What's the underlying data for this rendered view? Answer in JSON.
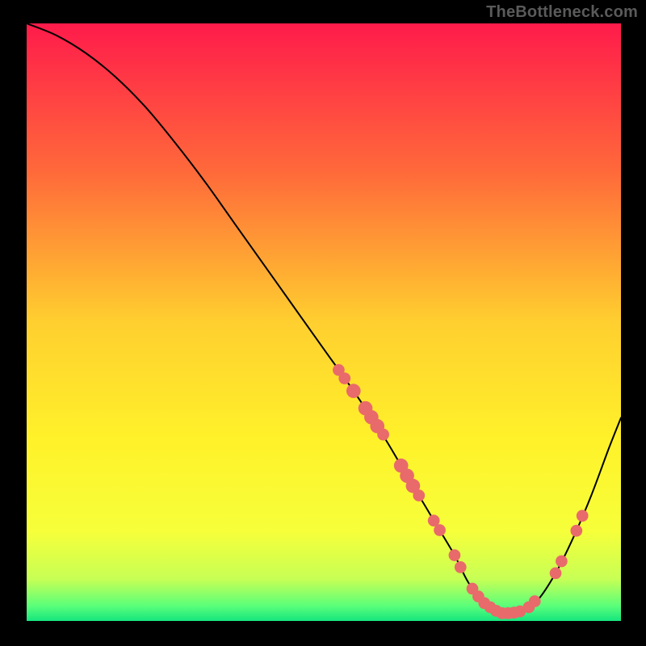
{
  "watermark": "TheBottleneck.com",
  "chart_data": {
    "type": "line",
    "title": "",
    "xlabel": "",
    "ylabel": "",
    "xlim": [
      0,
      100
    ],
    "ylim": [
      0,
      100
    ],
    "grid": false,
    "legend": false,
    "gradient_stops": [
      {
        "offset": 0.0,
        "color": "#ff1b4b"
      },
      {
        "offset": 0.25,
        "color": "#ff6a3a"
      },
      {
        "offset": 0.5,
        "color": "#ffcf2f"
      },
      {
        "offset": 0.7,
        "color": "#fff22a"
      },
      {
        "offset": 0.85,
        "color": "#f6ff3a"
      },
      {
        "offset": 0.93,
        "color": "#c7ff55"
      },
      {
        "offset": 0.975,
        "color": "#5aff7a"
      },
      {
        "offset": 1.0,
        "color": "#15e57e"
      }
    ],
    "series": [
      {
        "name": "bottleneck-curve",
        "x": [
          0,
          5,
          10,
          15,
          20,
          25,
          30,
          35,
          40,
          45,
          50,
          55,
          60,
          63,
          66,
          69,
          72,
          74,
          76,
          78,
          80,
          83,
          86,
          89,
          92,
          95,
          98,
          100
        ],
        "values": [
          100,
          98,
          95,
          91,
          86,
          80,
          73.5,
          66.5,
          59.5,
          52.5,
          45.5,
          38.5,
          31,
          26,
          21,
          16,
          11,
          7,
          4,
          2.3,
          1.3,
          1.3,
          3.5,
          8,
          14,
          21,
          29,
          34
        ]
      }
    ],
    "markers": {
      "name": "highlight-points",
      "color": "#e96a6a",
      "points": [
        {
          "x": 52.5,
          "y": 42.0,
          "r": 1.0
        },
        {
          "x": 53.5,
          "y": 40.6,
          "r": 1.0
        },
        {
          "x": 55.0,
          "y": 38.5,
          "r": 1.2
        },
        {
          "x": 57.0,
          "y": 35.6,
          "r": 1.2
        },
        {
          "x": 58.0,
          "y": 34.1,
          "r": 1.2
        },
        {
          "x": 59.0,
          "y": 32.6,
          "r": 1.2
        },
        {
          "x": 60.0,
          "y": 31.2,
          "r": 1.0
        },
        {
          "x": 63.0,
          "y": 26.0,
          "r": 1.2
        },
        {
          "x": 64.0,
          "y": 24.3,
          "r": 1.2
        },
        {
          "x": 65.0,
          "y": 22.6,
          "r": 1.2
        },
        {
          "x": 66.0,
          "y": 21.0,
          "r": 1.0
        },
        {
          "x": 68.5,
          "y": 16.8,
          "r": 1.0
        },
        {
          "x": 69.5,
          "y": 15.2,
          "r": 1.0
        },
        {
          "x": 72.0,
          "y": 11.0,
          "r": 1.0
        },
        {
          "x": 73.0,
          "y": 9.0,
          "r": 1.0
        },
        {
          "x": 75.0,
          "y": 5.4,
          "r": 1.0
        },
        {
          "x": 76.0,
          "y": 4.1,
          "r": 1.0
        },
        {
          "x": 77.0,
          "y": 3.0,
          "r": 1.0
        },
        {
          "x": 78.0,
          "y": 2.3,
          "r": 1.0
        },
        {
          "x": 79.0,
          "y": 1.7,
          "r": 1.0
        },
        {
          "x": 80.0,
          "y": 1.3,
          "r": 1.0
        },
        {
          "x": 81.0,
          "y": 1.3,
          "r": 1.0
        },
        {
          "x": 82.0,
          "y": 1.4,
          "r": 1.0
        },
        {
          "x": 83.0,
          "y": 1.6,
          "r": 1.0
        },
        {
          "x": 84.5,
          "y": 2.3,
          "r": 1.0
        },
        {
          "x": 85.5,
          "y": 3.3,
          "r": 1.0
        },
        {
          "x": 89.0,
          "y": 8.0,
          "r": 1.0
        },
        {
          "x": 90.0,
          "y": 10.0,
          "r": 1.0
        },
        {
          "x": 92.5,
          "y": 15.1,
          "r": 1.0
        },
        {
          "x": 93.5,
          "y": 17.6,
          "r": 1.0
        }
      ]
    }
  }
}
